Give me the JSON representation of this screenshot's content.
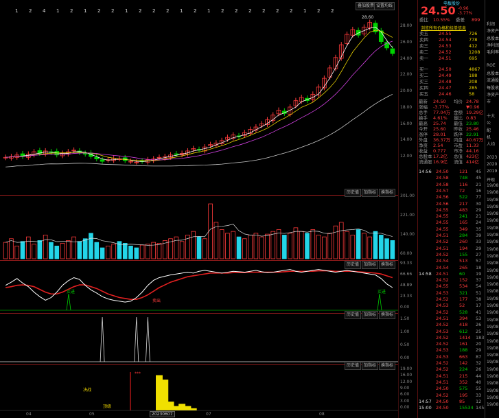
{
  "header": {
    "flags": [
      "1",
      "2",
      "4",
      "1",
      "2",
      "1",
      "2",
      "2",
      "1",
      "2",
      "2",
      "2",
      "1",
      "2",
      "1",
      "2",
      "2",
      "2",
      "2",
      "2",
      "2",
      "1",
      "2",
      "2"
    ],
    "btn_main_chart": "叠加股票",
    "btn_settings": "设置均线"
  },
  "chart": {
    "max_price_label": "28.60",
    "price_axis": [
      "28.00",
      "26.00",
      "24.00",
      "22.00",
      "20.00",
      "18.00",
      "16.00",
      "14.00",
      "12.00"
    ],
    "volume_axis": [
      "301.00",
      "221.00",
      "140.00",
      "60.00"
    ],
    "osc_axis": [
      "93.33",
      "66.66",
      "48.89",
      "23.33",
      "0.00"
    ],
    "signal_axis": [
      "1.50",
      "1.00",
      "0.50",
      "0.00"
    ],
    "bottom_axis": [
      "19.00",
      "16.00",
      "12.00",
      "9.00",
      "6.00",
      "3.00",
      "0.00"
    ],
    "x_labels": [
      "04",
      "05",
      "06",
      "07",
      "08"
    ],
    "date_box": "20230607",
    "pane_buttons": [
      "历史值",
      "加指标",
      "换指标"
    ],
    "signal_buttons": [
      "历史值",
      "加指标",
      "换指标"
    ],
    "annotations": {
      "green_left": "买进",
      "green_right": "买进",
      "red_low": "卖出",
      "bottom_label_a": "决战",
      "bottom_label_b": "顶级",
      "bottom_marker": "***"
    },
    "close_series": [
      11.5,
      11.6,
      11.8,
      11.6,
      11.9,
      12.2,
      12.0,
      12.3,
      12.1,
      11.8,
      12.0,
      12.2,
      12.4,
      12.1,
      11.9,
      11.6,
      11.3,
      11.0,
      11.2,
      11.4,
      11.3,
      11.1,
      11.0,
      10.9,
      11.0,
      11.2,
      11.3,
      11.5,
      11.6,
      11.8,
      11.9,
      12.0,
      12.3,
      12.6,
      12.4,
      12.8,
      13.1,
      13.3,
      13.6,
      14.0,
      14.3,
      14.1,
      14.6,
      15.0,
      15.3,
      15.7,
      16.2,
      16.8,
      17.4,
      17.0,
      17.8,
      18.6,
      19.0,
      18.6,
      19.4,
      20.3,
      21.4,
      22.7,
      24.0,
      25.6,
      26.9,
      27.5,
      26.8,
      27.8,
      28.4,
      27.2,
      26.0,
      25.2,
      24.5
    ],
    "volume_series": [
      90,
      110,
      70,
      95,
      120,
      80,
      100,
      130,
      90,
      70,
      85,
      100,
      120,
      95,
      110,
      140,
      90,
      60,
      70,
      80,
      95,
      85,
      70,
      60,
      75,
      80,
      90,
      85,
      100,
      110,
      120,
      95,
      130,
      150,
      120,
      110,
      301,
      200,
      160,
      140,
      150,
      120,
      110,
      130,
      140,
      120,
      135,
      150,
      160,
      130,
      140,
      170,
      150,
      140,
      160,
      130,
      120,
      140,
      180,
      200,
      150,
      130,
      160,
      140,
      120,
      150,
      130,
      110,
      100
    ],
    "fast_line": [
      55,
      62,
      70,
      60,
      52,
      40,
      30,
      22,
      28,
      40,
      55,
      65,
      72,
      68,
      55,
      45,
      38,
      30,
      25,
      22,
      20,
      18,
      20,
      28,
      40,
      55,
      66,
      72,
      75,
      78,
      80,
      82,
      84,
      82,
      86,
      88,
      86,
      84,
      82,
      84,
      86,
      85,
      84,
      86,
      88,
      85,
      83,
      84,
      86,
      88,
      90,
      86,
      84,
      86,
      88,
      90,
      88,
      86,
      84,
      86,
      88,
      86,
      84,
      82,
      80,
      78,
      70,
      58,
      50
    ],
    "slow_line": [
      50,
      52,
      55,
      56,
      55,
      52,
      46,
      40,
      36,
      36,
      40,
      46,
      52,
      56,
      56,
      52,
      48,
      42,
      36,
      32,
      28,
      26,
      24,
      24,
      28,
      34,
      42,
      50,
      56,
      62,
      66,
      70,
      74,
      76,
      78,
      80,
      82,
      82,
      82,
      82,
      83,
      83,
      83,
      84,
      84,
      84,
      84,
      84,
      84,
      85,
      86,
      86,
      86,
      86,
      86,
      87,
      87,
      87,
      86,
      86,
      86,
      86,
      85,
      84,
      83,
      82,
      80,
      76,
      72
    ],
    "signal_spikes": [
      17,
      23,
      25
    ],
    "bottom_bars": [
      0,
      0,
      0,
      0,
      0,
      0,
      0,
      0,
      0,
      0,
      0,
      0,
      0,
      0,
      0,
      0,
      0,
      0,
      0,
      0,
      0,
      0,
      0,
      0,
      0,
      0,
      0,
      16,
      14,
      4,
      2,
      3,
      2,
      1,
      0,
      0,
      0,
      0,
      0,
      0,
      0,
      0,
      0,
      0,
      0,
      0,
      0,
      0,
      0,
      0,
      0,
      0,
      0,
      0,
      0,
      0,
      0,
      0,
      0,
      0,
      0,
      0,
      0,
      0,
      0,
      0,
      0,
      0,
      0
    ]
  },
  "quote": {
    "title": "电板股份",
    "price": "24.50",
    "change_abs": "-0.96",
    "change_pct": "-3.77%",
    "commission_label": "委比",
    "commission_value": "10.55%",
    "commission_diff_label": "委差",
    "commission_diff": "899",
    "link_text": "浏览所有价格和挂单信息",
    "sell": [
      {
        "label": "卖五",
        "price": "24.55",
        "vol": "726"
      },
      {
        "label": "卖四",
        "price": "24.54",
        "vol": "778"
      },
      {
        "label": "卖三",
        "price": "24.53",
        "vol": "412"
      },
      {
        "label": "卖二",
        "price": "24.52",
        "vol": "1208"
      },
      {
        "label": "卖一",
        "price": "24.51",
        "vol": "695"
      }
    ],
    "buy": [
      {
        "label": "买一",
        "price": "24.50",
        "vol": "4867"
      },
      {
        "label": "买二",
        "price": "24.49",
        "vol": "188"
      },
      {
        "label": "买三",
        "price": "24.48",
        "vol": "208"
      },
      {
        "label": "买四",
        "price": "24.47",
        "vol": "285"
      },
      {
        "label": "买五",
        "price": "24.46",
        "vol": "58"
      }
    ],
    "stats": [
      {
        "l1": "最新",
        "v1": "24.50",
        "l2": "均价",
        "v2": "24.78"
      },
      {
        "l1": "涨幅",
        "v1": "-3.77%",
        "l2": "",
        "v2": "▼0.96"
      },
      {
        "l1": "总手",
        "v1": "77.04万",
        "l2": "金额",
        "v2": "19.29亿"
      },
      {
        "l1": "换手",
        "v1": "4.61%",
        "l2": "量比",
        "v2": "0.83"
      },
      {
        "l1": "最高",
        "v1": "25.74",
        "l2": "最低",
        "v2": "23.80"
      },
      {
        "l1": "今开",
        "v1": "25.60",
        "l2": "昨收",
        "v2": "25.46"
      },
      {
        "l1": "涨停",
        "v1": "28.01",
        "l2": "跌停",
        "v2": "22.91"
      },
      {
        "l1": "外盘",
        "v1": "36.37万",
        "l2": "内盘",
        "v2": "40.67万"
      },
      {
        "l1": "净资",
        "v1": "2.54",
        "l2": "市盈",
        "v2": "11.33"
      },
      {
        "l1": "收益",
        "v1": "0.777",
        "l2": "市净",
        "v2": "44.16"
      },
      {
        "l1": "总股本",
        "v1": "17.2亿",
        "l2": "总值",
        "v2": "423亿"
      },
      {
        "l1": "流通股",
        "v1": "16.9亿",
        "l2": "流值",
        "v2": "414亿"
      }
    ],
    "ticks": [
      {
        "t": "14:56",
        "p": "24.50",
        "v": "121",
        "n": "45"
      },
      {
        "t": "",
        "p": "24.58",
        "v": "748",
        "n": "45"
      },
      {
        "t": "",
        "p": "24.58",
        "v": "116",
        "n": "21"
      },
      {
        "t": "",
        "p": "24.57",
        "v": "72",
        "n": "16"
      },
      {
        "t": "",
        "p": "24.56",
        "v": "522",
        "n": "77"
      },
      {
        "t": "",
        "p": "24.56",
        "v": "217",
        "n": "30"
      },
      {
        "t": "",
        "p": "24.55",
        "v": "483",
        "n": "29"
      },
      {
        "t": "",
        "p": "24.55",
        "v": "241",
        "n": "21"
      },
      {
        "t": "",
        "p": "24.55",
        "v": "165",
        "n": "24"
      },
      {
        "t": "",
        "p": "24.55",
        "v": "349",
        "n": "35"
      },
      {
        "t": "",
        "p": "24.51",
        "v": "284",
        "n": "39"
      },
      {
        "t": "",
        "p": "24.52",
        "v": "260",
        "n": "33"
      },
      {
        "t": "",
        "p": "24.51",
        "v": "194",
        "n": "29"
      },
      {
        "t": "",
        "p": "24.52",
        "v": "155",
        "n": "27"
      },
      {
        "t": "",
        "p": "24.54",
        "v": "513",
        "n": "57"
      },
      {
        "t": "",
        "p": "24.54",
        "v": "265",
        "n": "18"
      },
      {
        "t": "14:58",
        "p": "24.51",
        "v": "60",
        "n": "19"
      },
      {
        "t": "",
        "p": "24.52",
        "v": "152",
        "n": "37"
      },
      {
        "t": "",
        "p": "24.55",
        "v": "534",
        "n": "54"
      },
      {
        "t": "",
        "p": "24.53",
        "v": "321",
        "n": "51"
      },
      {
        "t": "",
        "p": "24.52",
        "v": "177",
        "n": "38"
      },
      {
        "t": "",
        "p": "24.53",
        "v": "52",
        "n": "17"
      },
      {
        "t": "",
        "p": "24.52",
        "v": "528",
        "n": "41"
      },
      {
        "t": "",
        "p": "24.51",
        "v": "394",
        "n": "53"
      },
      {
        "t": "",
        "p": "24.52",
        "v": "418",
        "n": "26"
      },
      {
        "t": "",
        "p": "24.53",
        "v": "612",
        "n": "25"
      },
      {
        "t": "",
        "p": "24.52",
        "v": "1414",
        "n": "183"
      },
      {
        "t": "",
        "p": "24.52",
        "v": "161",
        "n": "20"
      },
      {
        "t": "",
        "p": "24.53",
        "v": "188",
        "n": "29"
      },
      {
        "t": "",
        "p": "24.53",
        "v": "663",
        "n": "87"
      },
      {
        "t": "",
        "p": "24.52",
        "v": "142",
        "n": "32"
      },
      {
        "t": "",
        "p": "24.52",
        "v": "224",
        "n": "26"
      },
      {
        "t": "",
        "p": "24.51",
        "v": "215",
        "n": "44"
      },
      {
        "t": "",
        "p": "24.51",
        "v": "352",
        "n": "40"
      },
      {
        "t": "",
        "p": "24.50",
        "v": "575",
        "n": "55"
      },
      {
        "t": "",
        "p": "24.52",
        "v": "195",
        "n": "33"
      },
      {
        "t": "14:57",
        "p": "24.50",
        "v": "85",
        "n": "12"
      },
      {
        "t": "15:00",
        "p": "24.50",
        "v": "15534",
        "n": "1454"
      }
    ]
  },
  "far": {
    "items": [
      "利润",
      "净资产",
      "总股本",
      "净利润",
      "毛利率",
      "",
      "ROE",
      "总股本",
      "流通股",
      "每股收益",
      "净资产",
      "市",
      "",
      "十大",
      "公",
      "配",
      "机",
      "人均",
      "",
      "2023",
      "2020",
      "2019",
      "开现",
      "19/08",
      "19/08",
      "19/08",
      "19/08",
      "19/08",
      "19/08",
      "19/08",
      "19/08",
      "19/08",
      "19/08",
      "19/08",
      "19/08",
      "19/08",
      "19/08",
      "19/08",
      "19/08",
      "19/08",
      "19/08",
      "19/08",
      "19/08",
      "19/08",
      "19/08",
      "19/08",
      "19/08",
      "19/08",
      "19/08",
      "19/08",
      "19/08",
      "19/08",
      "19/08",
      "19/08",
      "19/08"
    ]
  },
  "colors": {
    "up": "#ff3b3b",
    "down": "#00d200",
    "vol_cyan": "#23d5e8",
    "ma5": "#ffffff",
    "ma10": "#e8d000",
    "ma20": "#d040e0",
    "ma60": "#cccccc"
  }
}
